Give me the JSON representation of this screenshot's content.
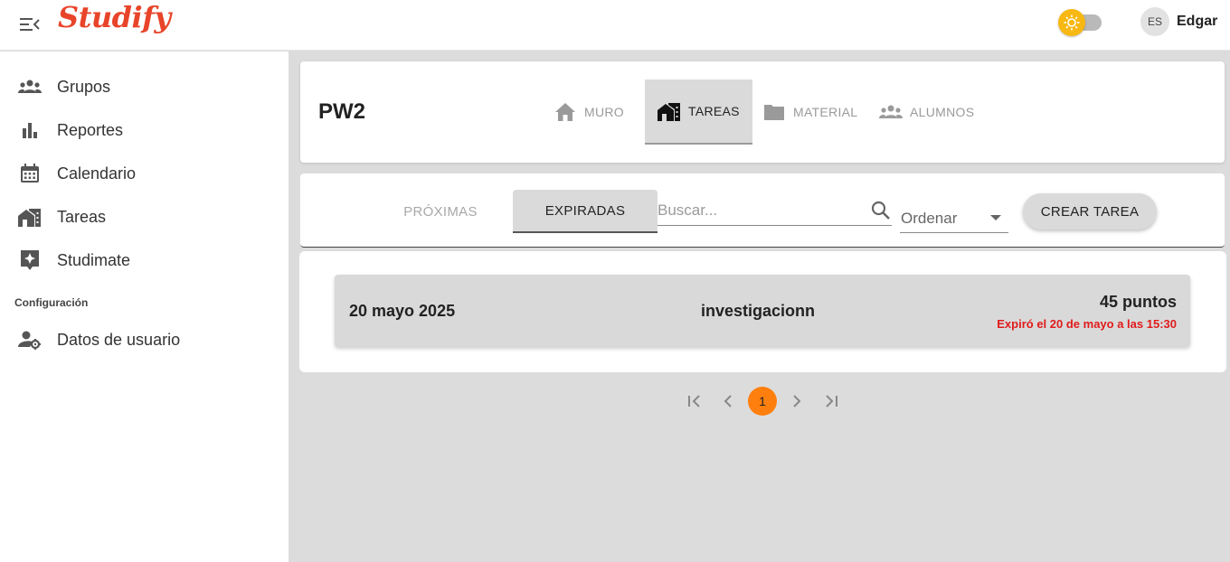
{
  "app": {
    "logo_text": "Studify",
    "brand_color": "#e8442a",
    "accent_color": "#ff7f0e"
  },
  "topbar": {
    "menu_icon": "menu-collapse-icon",
    "theme_icon": "sun-icon",
    "theme_toggle_state": "light",
    "avatar_initials": "ES",
    "user_name": "Edgar"
  },
  "sidebar": {
    "items": [
      {
        "label": "Grupos",
        "icon": "groups-icon"
      },
      {
        "label": "Reportes",
        "icon": "bar-chart-icon"
      },
      {
        "label": "Calendario",
        "icon": "calendar-icon"
      },
      {
        "label": "Tareas",
        "icon": "tasks-icon"
      },
      {
        "label": "Studimate",
        "icon": "sparkle-icon"
      }
    ],
    "section_label": "Configuración",
    "config_items": [
      {
        "label": "Datos de usuario",
        "icon": "user-settings-icon"
      }
    ]
  },
  "header": {
    "group_name": "PW2",
    "tabs": [
      {
        "label": "MURO",
        "icon": "home-icon",
        "active": false
      },
      {
        "label": "TAREAS",
        "icon": "tasks-icon",
        "active": true
      },
      {
        "label": "MATERIAL",
        "icon": "folder-icon",
        "active": false
      },
      {
        "label": "ALUMNOS",
        "icon": "students-icon",
        "active": false
      }
    ]
  },
  "filters": {
    "tabs": [
      {
        "label": "PRÓXIMAS",
        "active": false
      },
      {
        "label": "EXPIRADAS",
        "active": true
      }
    ],
    "search_placeholder": "Buscar...",
    "search_value": "",
    "order_label": "Ordenar",
    "create_button": "CREAR TAREA"
  },
  "tasks": [
    {
      "date": "20 mayo 2025",
      "title": "investigacionn",
      "points": "45 puntos",
      "status": "Expiró el 20 de mayo a las 15:30",
      "status_color": "#e01b1b"
    }
  ],
  "pagination": {
    "current_page": "1",
    "first_icon": "first-page-icon",
    "prev_icon": "chevron-left-icon",
    "next_icon": "chevron-right-icon",
    "last_icon": "last-page-icon"
  }
}
